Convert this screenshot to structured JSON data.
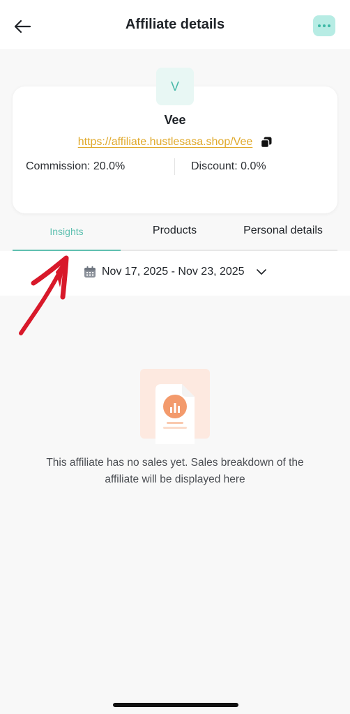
{
  "header": {
    "title": "Affiliate details",
    "back_icon": "arrow-left-icon",
    "more_icon": "more-horizontal-icon"
  },
  "affiliate": {
    "avatar_letter": "V",
    "name": "Vee",
    "link": "https://affiliate.hustlesasa.shop/Vee",
    "commission": "Commission: 20.0%",
    "discount": "Discount: 0.0%"
  },
  "tabs": [
    {
      "label": "Insights",
      "active": true
    },
    {
      "label": "Products",
      "active": false
    },
    {
      "label": "Personal details",
      "active": false
    }
  ],
  "date_range": {
    "label": "Nov 17, 2025 - Nov 23, 2025"
  },
  "empty_state": {
    "message": "This affiliate has no sales yet. Sales breakdown of the affiliate will be displayed here"
  },
  "colors": {
    "accent": "#5fc0b0",
    "link": "#e0a92b",
    "annotation": "#d8192a"
  }
}
